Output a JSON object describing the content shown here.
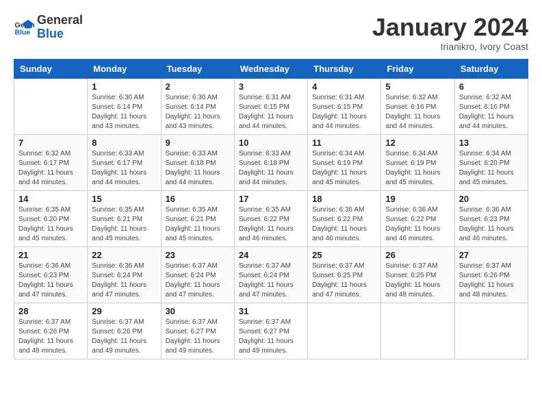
{
  "header": {
    "logo_general": "General",
    "logo_blue": "Blue",
    "month_title": "January 2024",
    "subtitle": "Irianikro, Ivory Coast"
  },
  "weekdays": [
    "Sunday",
    "Monday",
    "Tuesday",
    "Wednesday",
    "Thursday",
    "Friday",
    "Saturday"
  ],
  "weeks": [
    [
      {
        "day": "",
        "sunrise": "",
        "sunset": "",
        "daylight": ""
      },
      {
        "day": "1",
        "sunrise": "6:30 AM",
        "sunset": "6:14 PM",
        "daylight": "11 hours and 43 minutes."
      },
      {
        "day": "2",
        "sunrise": "6:30 AM",
        "sunset": "6:14 PM",
        "daylight": "11 hours and 43 minutes."
      },
      {
        "day": "3",
        "sunrise": "6:31 AM",
        "sunset": "6:15 PM",
        "daylight": "11 hours and 44 minutes."
      },
      {
        "day": "4",
        "sunrise": "6:31 AM",
        "sunset": "6:15 PM",
        "daylight": "11 hours and 44 minutes."
      },
      {
        "day": "5",
        "sunrise": "6:32 AM",
        "sunset": "6:16 PM",
        "daylight": "11 hours and 44 minutes."
      },
      {
        "day": "6",
        "sunrise": "6:32 AM",
        "sunset": "6:16 PM",
        "daylight": "11 hours and 44 minutes."
      }
    ],
    [
      {
        "day": "7",
        "sunrise": "6:32 AM",
        "sunset": "6:17 PM",
        "daylight": "11 hours and 44 minutes."
      },
      {
        "day": "8",
        "sunrise": "6:33 AM",
        "sunset": "6:17 PM",
        "daylight": "11 hours and 44 minutes."
      },
      {
        "day": "9",
        "sunrise": "6:33 AM",
        "sunset": "6:18 PM",
        "daylight": "11 hours and 44 minutes."
      },
      {
        "day": "10",
        "sunrise": "6:33 AM",
        "sunset": "6:18 PM",
        "daylight": "11 hours and 44 minutes."
      },
      {
        "day": "11",
        "sunrise": "6:34 AM",
        "sunset": "6:19 PM",
        "daylight": "11 hours and 45 minutes."
      },
      {
        "day": "12",
        "sunrise": "6:34 AM",
        "sunset": "6:19 PM",
        "daylight": "11 hours and 45 minutes."
      },
      {
        "day": "13",
        "sunrise": "6:34 AM",
        "sunset": "6:20 PM",
        "daylight": "11 hours and 45 minutes."
      }
    ],
    [
      {
        "day": "14",
        "sunrise": "6:35 AM",
        "sunset": "6:20 PM",
        "daylight": "11 hours and 45 minutes."
      },
      {
        "day": "15",
        "sunrise": "6:35 AM",
        "sunset": "6:21 PM",
        "daylight": "11 hours and 45 minutes."
      },
      {
        "day": "16",
        "sunrise": "6:35 AM",
        "sunset": "6:21 PM",
        "daylight": "11 hours and 45 minutes."
      },
      {
        "day": "17",
        "sunrise": "6:35 AM",
        "sunset": "6:22 PM",
        "daylight": "11 hours and 46 minutes."
      },
      {
        "day": "18",
        "sunrise": "6:36 AM",
        "sunset": "6:22 PM",
        "daylight": "11 hours and 46 minutes."
      },
      {
        "day": "19",
        "sunrise": "6:36 AM",
        "sunset": "6:22 PM",
        "daylight": "11 hours and 46 minutes."
      },
      {
        "day": "20",
        "sunrise": "6:36 AM",
        "sunset": "6:23 PM",
        "daylight": "11 hours and 46 minutes."
      }
    ],
    [
      {
        "day": "21",
        "sunrise": "6:36 AM",
        "sunset": "6:23 PM",
        "daylight": "11 hours and 47 minutes."
      },
      {
        "day": "22",
        "sunrise": "6:36 AM",
        "sunset": "6:24 PM",
        "daylight": "11 hours and 47 minutes."
      },
      {
        "day": "23",
        "sunrise": "6:37 AM",
        "sunset": "6:24 PM",
        "daylight": "11 hours and 47 minutes."
      },
      {
        "day": "24",
        "sunrise": "6:37 AM",
        "sunset": "6:24 PM",
        "daylight": "11 hours and 47 minutes."
      },
      {
        "day": "25",
        "sunrise": "6:37 AM",
        "sunset": "6:25 PM",
        "daylight": "11 hours and 47 minutes."
      },
      {
        "day": "26",
        "sunrise": "6:37 AM",
        "sunset": "6:25 PM",
        "daylight": "11 hours and 48 minutes."
      },
      {
        "day": "27",
        "sunrise": "6:37 AM",
        "sunset": "6:26 PM",
        "daylight": "11 hours and 48 minutes."
      }
    ],
    [
      {
        "day": "28",
        "sunrise": "6:37 AM",
        "sunset": "6:26 PM",
        "daylight": "11 hours and 48 minutes."
      },
      {
        "day": "29",
        "sunrise": "6:37 AM",
        "sunset": "6:26 PM",
        "daylight": "11 hours and 49 minutes."
      },
      {
        "day": "30",
        "sunrise": "6:37 AM",
        "sunset": "6:27 PM",
        "daylight": "11 hours and 49 minutes."
      },
      {
        "day": "31",
        "sunrise": "6:37 AM",
        "sunset": "6:27 PM",
        "daylight": "11 hours and 49 minutes."
      },
      {
        "day": "",
        "sunrise": "",
        "sunset": "",
        "daylight": ""
      },
      {
        "day": "",
        "sunrise": "",
        "sunset": "",
        "daylight": ""
      },
      {
        "day": "",
        "sunrise": "",
        "sunset": "",
        "daylight": ""
      }
    ]
  ],
  "labels": {
    "sunrise_prefix": "Sunrise: ",
    "sunset_prefix": "Sunset: ",
    "daylight_prefix": "Daylight: "
  }
}
